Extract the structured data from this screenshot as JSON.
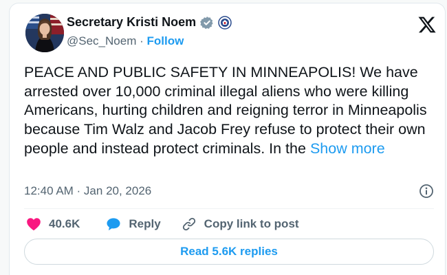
{
  "author": {
    "display_name": "Secretary Kristi Noem",
    "handle": "@Sec_Noem",
    "separator": "·",
    "follow_label": "Follow",
    "verified_color": "#829aab",
    "avatar_alt": "profile-photo"
  },
  "tweet": {
    "text": "PEACE AND PUBLIC SAFETY IN MINNEAPOLIS! We have arrested over 10,000 criminal illegal aliens who were killing Americans, hurting children and reigning terror in Minneapolis because Tim Walz and Jacob Frey refuse to protect their own people and instead protect criminals. In the",
    "show_more_label": "Show more",
    "timestamp": "12:40 AM · Jan 20, 2026"
  },
  "actions": {
    "like_count": "40.6K",
    "reply_label": "Reply",
    "copy_link_label": "Copy link to post"
  },
  "footer": {
    "read_replies_label": "Read 5.6K replies"
  },
  "colors": {
    "accent": "#1d9bf0",
    "like": "#f91880",
    "text": "#0f1419",
    "muted": "#536471"
  }
}
